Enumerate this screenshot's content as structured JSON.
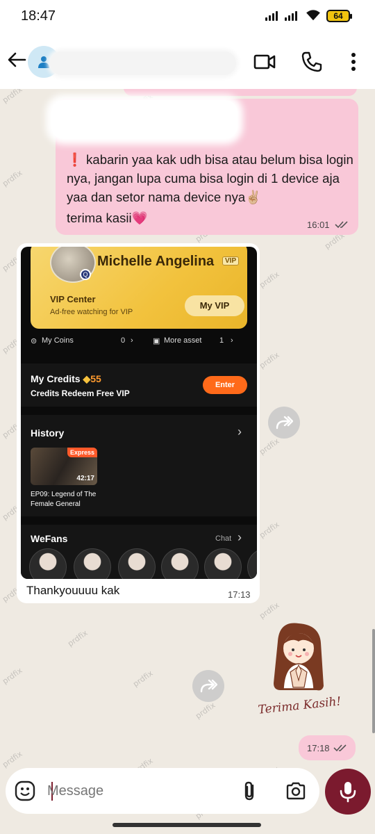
{
  "status_bar": {
    "time": "18:47",
    "battery": "64"
  },
  "header": {
    "back_icon": "arrow-left-icon",
    "avatar_icon": "person-icon",
    "video_icon": "video-camera-icon",
    "call_icon": "phone-icon",
    "menu_icon": "more-vertical-icon"
  },
  "messages": [
    {
      "direction": "outgoing",
      "lines": [
        "❗ kabarin yaa kak udh bisa atau belum bisa login",
        "nya, jangan lupa cuma bisa login di 1 device aja",
        "yaa dan setor nama device nya✌🏼",
        "terima kasii💗"
      ],
      "time": "16:01"
    },
    {
      "direction": "incoming",
      "image": {
        "profile_name": "Michelle Angelina",
        "vip_tag": "VIP",
        "vip_center": "VIP Center",
        "vip_sub": "Ad-free watching for VIP",
        "my_vip_button": "My VIP",
        "my_coins_label": "My Coins",
        "my_coins_value": "0",
        "more_asset_label": "More asset",
        "more_asset_value": "1",
        "credits_title": "My Credits",
        "credits_value": "55",
        "credits_sub": "Credits Redeem Free VIP",
        "enter_button": "Enter",
        "history_title": "History",
        "express_badge": "Express",
        "video_duration": "42:17",
        "episode_title": "EP09: Legend of The Female General",
        "wefans_title": "WeFans",
        "chat_link": "Chat"
      },
      "caption": "Thankyouuuu kak",
      "time": "17:13"
    },
    {
      "direction": "outgoing",
      "sticker_text": "Terima Kasih!",
      "time": "17:18"
    }
  ],
  "composer": {
    "placeholder": "Message",
    "emoji_icon": "emoji-icon",
    "attach_icon": "paperclip-icon",
    "camera_icon": "camera-icon",
    "mic_icon": "microphone-icon"
  },
  "watermark": "prdfix",
  "colors": {
    "outgoing_bubble": "#f9c8d8",
    "incoming_bubble": "#ffffff",
    "mic_button": "#7b1a2e",
    "chat_background": "#efeae2"
  }
}
